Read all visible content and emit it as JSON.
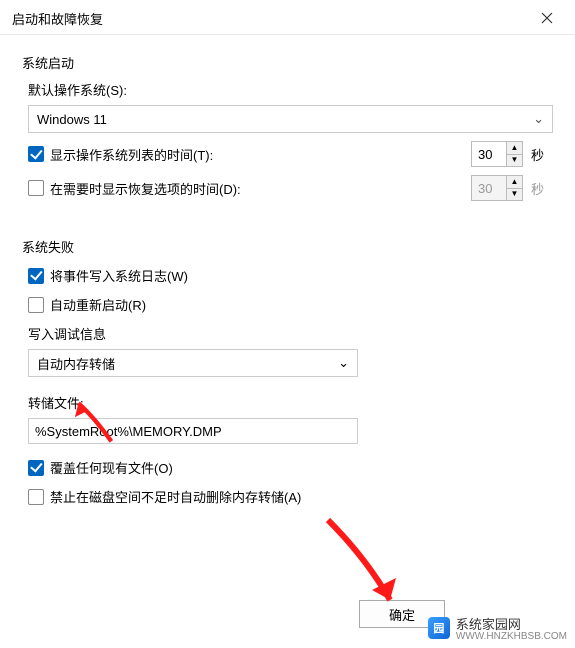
{
  "title": "启动和故障恢复",
  "section_startup": {
    "title": "系统启动",
    "default_os_label": "默认操作系统(S):",
    "default_os_value": "Windows 11",
    "show_os_list": {
      "checked": true,
      "label": "显示操作系统列表的时间(T):",
      "value": "30",
      "unit": "秒"
    },
    "show_recovery": {
      "checked": false,
      "label": "在需要时显示恢复选项的时间(D):",
      "value": "30",
      "unit": "秒"
    }
  },
  "section_failure": {
    "title": "系统失败",
    "write_event": {
      "checked": true,
      "label": "将事件写入系统日志(W)"
    },
    "auto_restart": {
      "checked": false,
      "label": "自动重新启动(R)"
    },
    "debug_info_label": "写入调试信息",
    "debug_select_value": "自动内存转储",
    "dump_file_label": "转储文件:",
    "dump_file_value": "%SystemRoot%\\MEMORY.DMP",
    "overwrite": {
      "checked": true,
      "label": "覆盖任何现有文件(O)"
    },
    "no_delete": {
      "checked": false,
      "label": "禁止在磁盘空间不足时自动删除内存转储(A)"
    }
  },
  "buttons": {
    "ok": "确定"
  },
  "watermark": {
    "text": "系统家园网",
    "sub": "WWW.HNZKHBSB.COM"
  }
}
